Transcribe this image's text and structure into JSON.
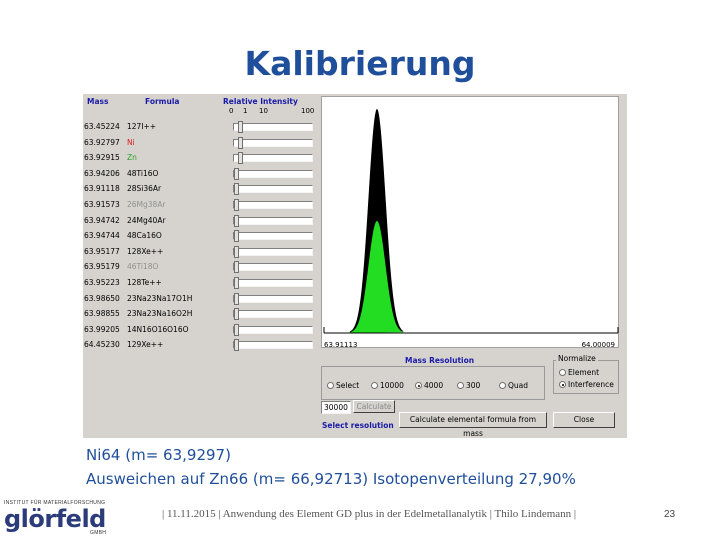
{
  "slide": {
    "title": "Kalibrierung",
    "caption_line1": "Ni64 (m= 63,9297)",
    "caption_line2": "Ausweichen auf Zn66 (m= 66,92713)  Isotopenverteilung 27,90%",
    "footer": "| 11.11.2015 | Anwendung des Element GD plus in der Edelmetallanalytik | Thilo Lindemann |",
    "page_number": "23"
  },
  "logo": {
    "tagline": "INSTITUT FÜR MATERIALFORSCHUNG",
    "wordmark": "glörfeld",
    "sub": "GMBH"
  },
  "dialog": {
    "headers": {
      "mass": "Mass",
      "formula": "Formula",
      "relative_intensity": "Relative Intensity"
    },
    "scale": [
      "0",
      "1",
      "10",
      "100"
    ],
    "rows": [
      {
        "mass": "63.45224",
        "formula": "127I++",
        "color": "#000000",
        "fraction": 0.06
      },
      {
        "mass": "63.92797",
        "formula": "Ni",
        "color": "#d42020",
        "fraction": 0.06
      },
      {
        "mass": "63.92915",
        "formula": "Zn",
        "color": "#28a028",
        "fraction": 0.06
      },
      {
        "mass": "63.94206",
        "formula": "48Ti16O",
        "color": "#000000",
        "fraction": 0.0
      },
      {
        "mass": "63.91118",
        "formula": "28Si36Ar",
        "color": "#000000",
        "fraction": 0.0
      },
      {
        "mass": "63.91573",
        "formula": "26Mg38Ar",
        "color": "#909090",
        "fraction": 0.0
      },
      {
        "mass": "63.94742",
        "formula": "24Mg40Ar",
        "color": "#000000",
        "fraction": 0.0
      },
      {
        "mass": "63.94744",
        "formula": "48Ca16O",
        "color": "#000000",
        "fraction": 0.0
      },
      {
        "mass": "63.95177",
        "formula": "128Xe++",
        "color": "#000000",
        "fraction": 0.0
      },
      {
        "mass": "63.95179",
        "formula": "46Ti18O",
        "color": "#909090",
        "fraction": 0.0
      },
      {
        "mass": "63.95223",
        "formula": "128Te++",
        "color": "#000000",
        "fraction": 0.0
      },
      {
        "mass": "63.98650",
        "formula": "23Na23Na17O1H",
        "color": "#000000",
        "fraction": 0.0
      },
      {
        "mass": "63.98855",
        "formula": "23Na23Na16O2H",
        "color": "#000000",
        "fraction": 0.0
      },
      {
        "mass": "63.99205",
        "formula": "14N16O16O16O",
        "color": "#000000",
        "fraction": 0.0
      },
      {
        "mass": "64.45230",
        "formula": "129Xe++",
        "color": "#000000",
        "fraction": 0.0
      }
    ],
    "plot": {
      "x_min_label": "63.91113",
      "x_max_label": "64.00009"
    },
    "mass_resolution": {
      "title": "Mass Resolution",
      "options": [
        "Select",
        "10000",
        "4000",
        "300",
        "Quad"
      ],
      "selected": "4000"
    },
    "normalize": {
      "title": "Normalize",
      "options": [
        "Element",
        "Interference"
      ],
      "selected": "Interference"
    },
    "resolution_value": "30000",
    "calculate_button": "Calculate",
    "select_resolution_link": "Select resolution",
    "calc_formula_button": "Calculate elemental formula from mass",
    "close_button": "Close"
  },
  "colors": {
    "title": "#1f4e9a",
    "peak_outer": "#000000",
    "peak_inner": "#22dd22",
    "dialog_bg": "#d6d3ce",
    "accent_text": "#1a1aa8"
  }
}
